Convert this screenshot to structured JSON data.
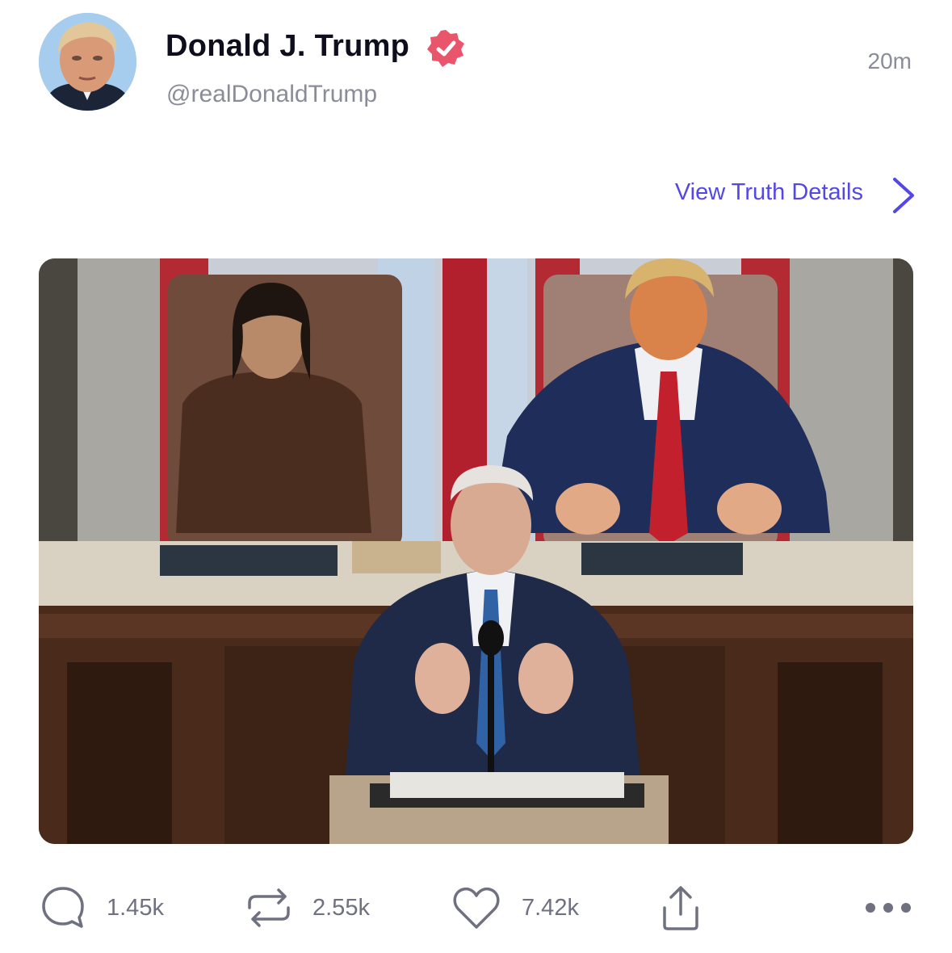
{
  "post": {
    "author_name": "Donald J. Trump",
    "handle": "@realDonaldTrump",
    "timestamp": "20m",
    "verified": true,
    "details_link": "View Truth Details"
  },
  "actions": {
    "replies": "1.45k",
    "retruths": "2.55k",
    "likes": "7.42k"
  },
  "icons": [
    "verified-icon",
    "chevron-right-icon",
    "comment-icon",
    "retruth-icon",
    "heart-icon",
    "share-icon",
    "more-icon"
  ],
  "colors": {
    "accent": "#5447e8",
    "verified_badge": "#e9556b",
    "muted_text": "#8b8c99",
    "primary_text": "#0e0e1d"
  }
}
